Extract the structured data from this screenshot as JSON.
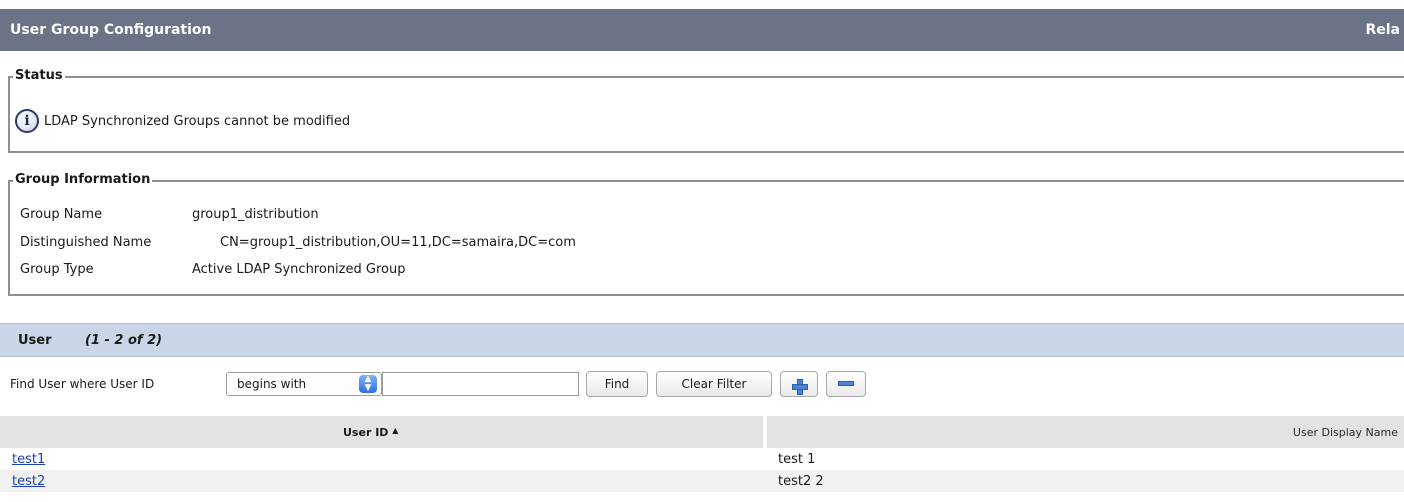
{
  "header": {
    "title": "User Group Configuration",
    "related": "Rela"
  },
  "status": {
    "legend": "Status",
    "icon": "info-icon",
    "icon_glyph": "i",
    "message": "LDAP Synchronized Groups cannot be modified"
  },
  "group_info": {
    "legend": "Group Information",
    "rows": [
      {
        "label": "Group Name",
        "value": "group1_distribution"
      },
      {
        "label": "Distinguished Name",
        "value": "CN=group1_distribution,OU=11,DC=samaira,DC=com"
      },
      {
        "label": "Group Type",
        "value": "Active LDAP Synchronized Group"
      }
    ]
  },
  "users": {
    "label": "User",
    "count": "(1 - 2 of 2)",
    "search": {
      "label": "Find User where User ID",
      "operator": "begins with",
      "value": "",
      "find_label": "Find",
      "clear_label": "Clear Filter",
      "add_icon": "plus-icon",
      "remove_icon": "minus-icon"
    },
    "columns": {
      "user_id": "User ID",
      "sort_indicator": "▲",
      "display_name": "User Display Name"
    },
    "rows": [
      {
        "user_id": "test1",
        "display_name": "test 1"
      },
      {
        "user_id": "test2",
        "display_name": "test2 2"
      }
    ]
  },
  "colors": {
    "header_bg": "#6b7386",
    "section_bg": "#c9d6e8",
    "link": "#1c3fb8"
  }
}
